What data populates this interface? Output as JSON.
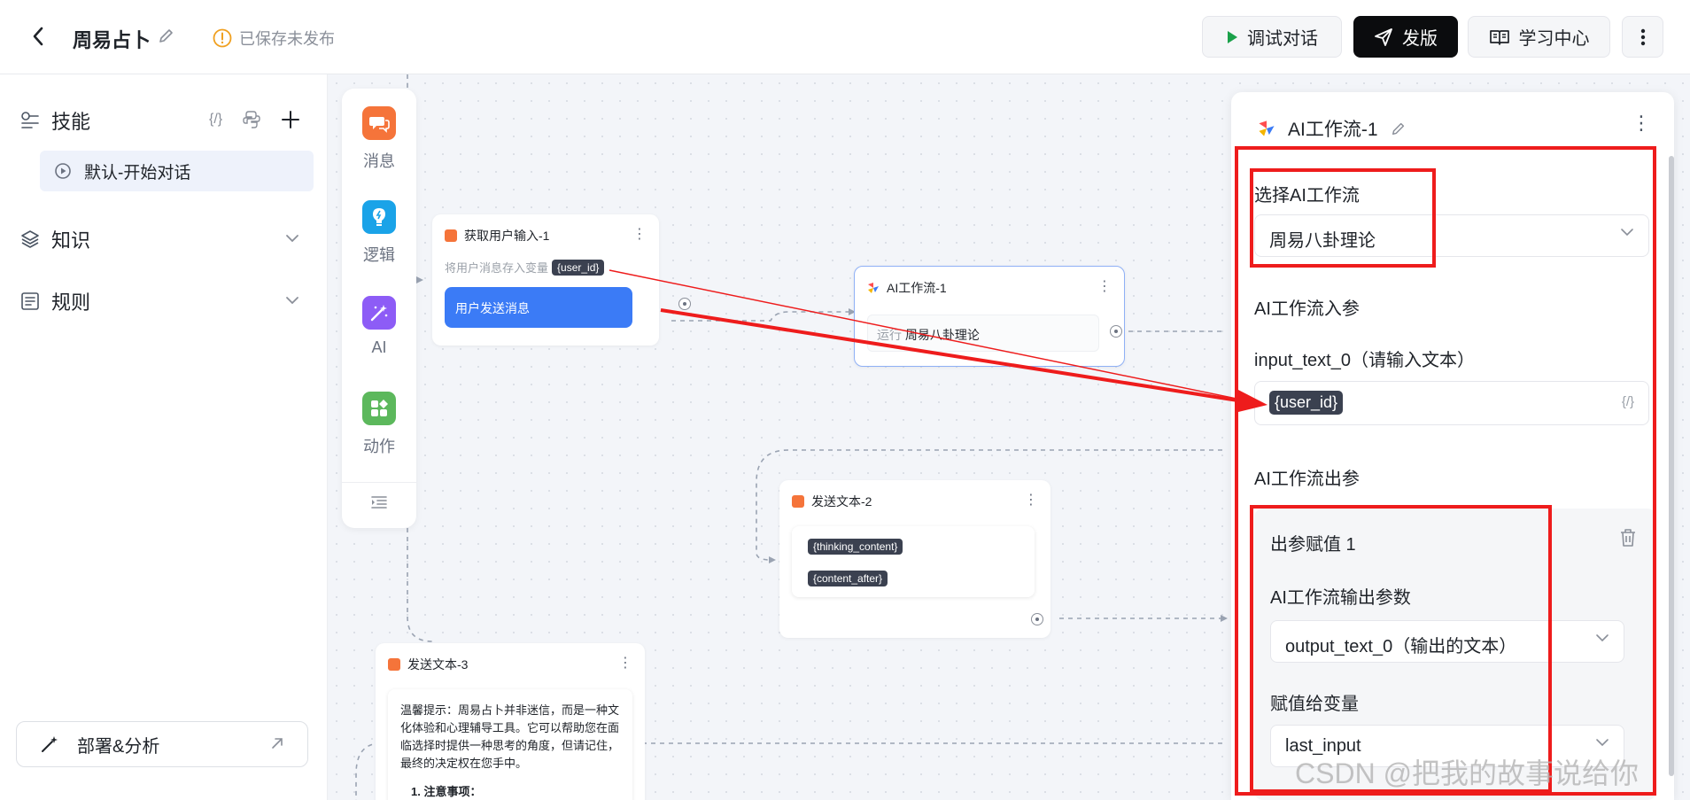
{
  "header": {
    "app_title": "周易占卜",
    "save_status": "已保存未发布",
    "debug_label": "调试对话",
    "publish_label": "发版",
    "learn_label": "学习中心"
  },
  "sidebar": {
    "skill_label": "技能",
    "code_glyph": "{/}",
    "skill_item": "默认-开始对话",
    "knowledge_label": "知识",
    "rules_label": "规则",
    "deploy_label": "部署&分析"
  },
  "palette": {
    "items": [
      {
        "label": "消息",
        "color": "#f5743a"
      },
      {
        "label": "逻辑",
        "color": "#1aa3e8"
      },
      {
        "label": "AI",
        "color": "#8d5cf6"
      },
      {
        "label": "动作",
        "color": "#5cb85c"
      }
    ]
  },
  "nodes": {
    "input": {
      "title": "获取用户输入-1",
      "hint": "将用户消息存入变量",
      "var": "{user_id}",
      "message": "用户发送消息"
    },
    "ai": {
      "title": "AI工作流-1",
      "run_prefix": "运行",
      "run_target": "周易八卦理论"
    },
    "send2": {
      "title": "发送文本-2",
      "var1": "{thinking_content}",
      "var2": "{content_after}"
    },
    "send3": {
      "title": "发送文本-3",
      "text": "温馨提示：周易占卜并非迷信，而是一种文化体验和心理辅导工具。它可以帮助您在面临选择时提供一种思考的角度，但请记住，最终的决定权在您手中。",
      "list_item": "1. 注意事项："
    }
  },
  "panel": {
    "title": "AI工作流-1",
    "select_label": "选择AI工作流",
    "selected_workflow": "周易八卦理论",
    "input_section": "AI工作流入参",
    "input_param_label": "input_text_0（请输入文本）",
    "input_param_value": "{user_id}",
    "code_glyph": "{/}",
    "output_section": "AI工作流出参",
    "output_card_title": "出参赋值 1",
    "output_param_label": "AI工作流输出参数",
    "output_param_value": "output_text_0（输出的文本）",
    "assign_label": "赋值给变量",
    "assign_value": "last_input"
  },
  "watermark": "CSDN @把我的故事说给你",
  "colors": {
    "accent_blue": "#3b7bf6",
    "annotation_red": "#ee1c1c",
    "publish_bg": "#0b0c0e"
  }
}
